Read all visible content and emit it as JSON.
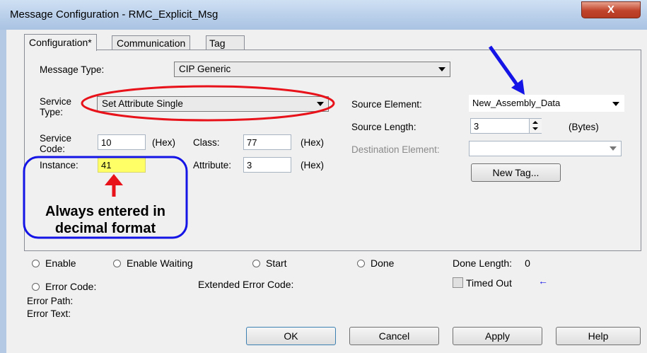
{
  "window": {
    "title": "Message Configuration - RMC_Explicit_Msg",
    "close_glyph": "X"
  },
  "tabs": [
    {
      "label": "Configuration*",
      "active": true
    },
    {
      "label": "Communication",
      "active": false
    },
    {
      "label": "Tag",
      "active": false
    }
  ],
  "config": {
    "message_type_label": "Message Type:",
    "message_type_value": "CIP Generic",
    "service_type_label_1": "Service",
    "service_type_label_2": "Type:",
    "service_type_value": "Set Attribute Single",
    "service_code_label_1": "Service",
    "service_code_label_2": "Code:",
    "service_code_value": "10",
    "hex_label": "(Hex)",
    "class_label": "Class:",
    "class_value": "77",
    "instance_label": "Instance:",
    "instance_value": "41",
    "attribute_label": "Attribute:",
    "attribute_value": "3",
    "source_element_label": "Source Element:",
    "source_element_value": "New_Assembly_Data",
    "source_length_label": "Source Length:",
    "source_length_value": "3",
    "bytes_label": "(Bytes)",
    "destination_element_label": "Destination Element:",
    "destination_element_value": "",
    "new_tag_button": "New Tag..."
  },
  "annotation": {
    "callout_line1": "Always entered in",
    "callout_line2": "decimal format",
    "colors": {
      "red": "#e8121a",
      "blue": "#1414e6",
      "highlight": "#ffff66"
    }
  },
  "status": {
    "enable": "Enable",
    "enable_waiting": "Enable Waiting",
    "start": "Start",
    "done": "Done",
    "done_length_label": "Done Length:",
    "done_length_value": "0",
    "error_code_label": "Error Code:",
    "extended_error_code_label": "Extended Error Code:",
    "timed_out_label": "Timed Out",
    "error_path_label": "Error Path:",
    "error_text_label": "Error Text:"
  },
  "buttons": {
    "ok": "OK",
    "cancel": "Cancel",
    "apply": "Apply",
    "help": "Help"
  }
}
